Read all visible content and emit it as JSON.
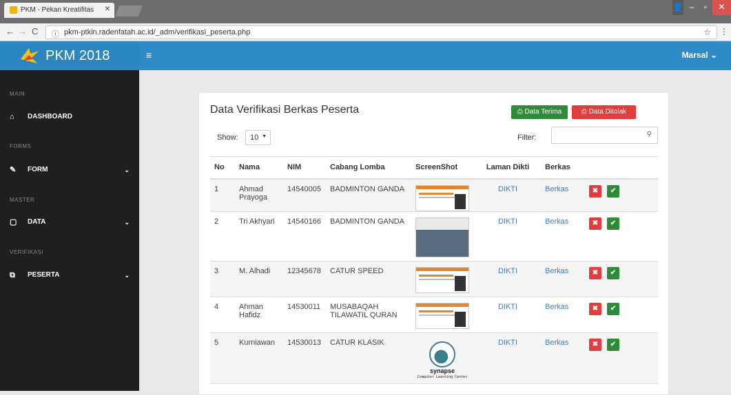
{
  "browser": {
    "tab_title": "PKM - Pekan Kreatifitas",
    "url": "pkm-ptkin.radenfatah.ac.id/_adm/verifikasi_peserta.php"
  },
  "app": {
    "brand": "PKM 2018",
    "user": "Marsal",
    "user_caret": "⌄"
  },
  "sidebar": {
    "sections": [
      {
        "label": "MAIN"
      },
      {
        "label": "FORMS"
      },
      {
        "label": "MASTER"
      },
      {
        "label": "VERIFIKASI"
      }
    ],
    "items": [
      {
        "label": "DASHBOARD",
        "icon": "home-icon"
      },
      {
        "label": "FORM",
        "icon": "pencil-icon"
      },
      {
        "label": "DATA",
        "icon": "file-icon"
      },
      {
        "label": "PESERTA",
        "icon": "windows-icon"
      }
    ]
  },
  "panel": {
    "title": "Data Verifikasi Berkas Peserta",
    "btn_terima": "Data Terima",
    "btn_tolak": "Data Ditolak",
    "show_label": "Show:",
    "show_value": "10",
    "filter_label": "Filter:"
  },
  "table": {
    "headers": [
      "No",
      "Nama",
      "NIM",
      "Cabang Lomba",
      "ScreenShot",
      "Laman Dikti",
      "Berkas"
    ],
    "rows": [
      {
        "no": "1",
        "nama": "Ahmad Prayoga",
        "nim": "14540005",
        "cabang": "BADMINTON GANDA",
        "shot": "web",
        "dikti": "DIKTI",
        "berkas": "Berkas"
      },
      {
        "no": "2",
        "nama": "Tri Akhyari",
        "nim": "14540166",
        "cabang": "BADMINTON GANDA",
        "shot": "photo",
        "dikti": "DIKTI",
        "berkas": "Berkas"
      },
      {
        "no": "3",
        "nama": "M. Alhadi",
        "nim": "12345678",
        "cabang": "CATUR SPEED",
        "shot": "web",
        "dikti": "DIKTI",
        "berkas": "Berkas"
      },
      {
        "no": "4",
        "nama": "Ahman Hafidz",
        "nim": "14530011",
        "cabang": "MUSABAQAH TILAWATIL QURAN",
        "shot": "web",
        "dikti": "DIKTI",
        "berkas": "Berkas"
      },
      {
        "no": "5",
        "nama": "Kurniawan",
        "nim": "14530013",
        "cabang": "CATUR KLASIK",
        "shot": "logo",
        "dikti": "DIKTI",
        "berkas": "Berkas"
      }
    ],
    "logo_text": "synapse",
    "logo_sub": "Computer Learning Center"
  },
  "colors": {
    "header": "#2e8bc6",
    "sidebar": "#1f1f1f",
    "success": "#2e8b38",
    "danger": "#e23d3d",
    "link": "#3b7fc4"
  }
}
